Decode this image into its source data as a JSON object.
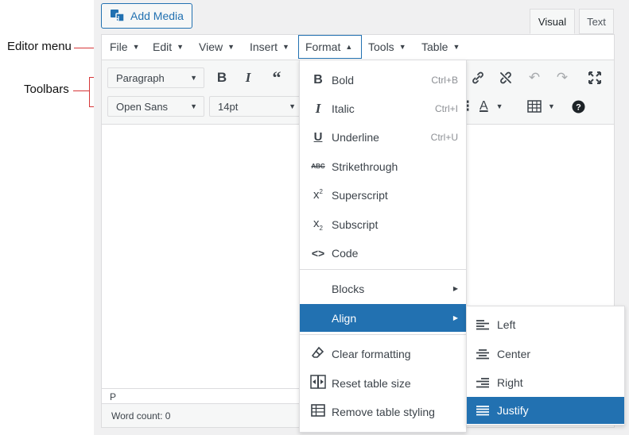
{
  "annotations": {
    "editor_menu_label": "Editor menu",
    "toolbars_label": "Toolbars"
  },
  "colors": {
    "accent": "#2271b1",
    "annotation": "#d63638"
  },
  "header": {
    "add_media": "Add Media",
    "tabs": [
      {
        "label": "Visual",
        "active": true
      },
      {
        "label": "Text",
        "active": false
      }
    ]
  },
  "menubar": {
    "items": [
      {
        "label": "File"
      },
      {
        "label": "Edit"
      },
      {
        "label": "View"
      },
      {
        "label": "Insert"
      },
      {
        "label": "Format",
        "open": true
      },
      {
        "label": "Tools"
      },
      {
        "label": "Table"
      }
    ]
  },
  "toolbar": {
    "block_select": "Paragraph",
    "font_select": "Open Sans",
    "size_select": "14pt"
  },
  "format_menu": {
    "items": [
      {
        "icon": "bold-icon",
        "label": "Bold",
        "shortcut": "Ctrl+B"
      },
      {
        "icon": "italic-icon",
        "label": "Italic",
        "shortcut": "Ctrl+I"
      },
      {
        "icon": "underline-icon",
        "label": "Underline",
        "shortcut": "Ctrl+U"
      },
      {
        "icon": "strikethrough-icon",
        "label": "Strikethrough",
        "shortcut": ""
      },
      {
        "icon": "superscript-icon",
        "label": "Superscript",
        "shortcut": ""
      },
      {
        "icon": "subscript-icon",
        "label": "Subscript",
        "shortcut": ""
      },
      {
        "icon": "code-icon",
        "label": "Code",
        "shortcut": ""
      }
    ],
    "blocks": "Blocks",
    "align": "Align",
    "bottom": [
      {
        "icon": "eraser-icon",
        "label": "Clear formatting"
      },
      {
        "icon": "resize-table-icon",
        "label": "Reset table size"
      },
      {
        "icon": "table-icon",
        "label": "Remove table styling"
      }
    ]
  },
  "align_menu": {
    "items": [
      {
        "label": "Left",
        "selected": false
      },
      {
        "label": "Center",
        "selected": false
      },
      {
        "label": "Right",
        "selected": false
      },
      {
        "label": "Justify",
        "selected": true
      }
    ]
  },
  "status": {
    "path": "P",
    "word_count": "Word count: 0"
  }
}
